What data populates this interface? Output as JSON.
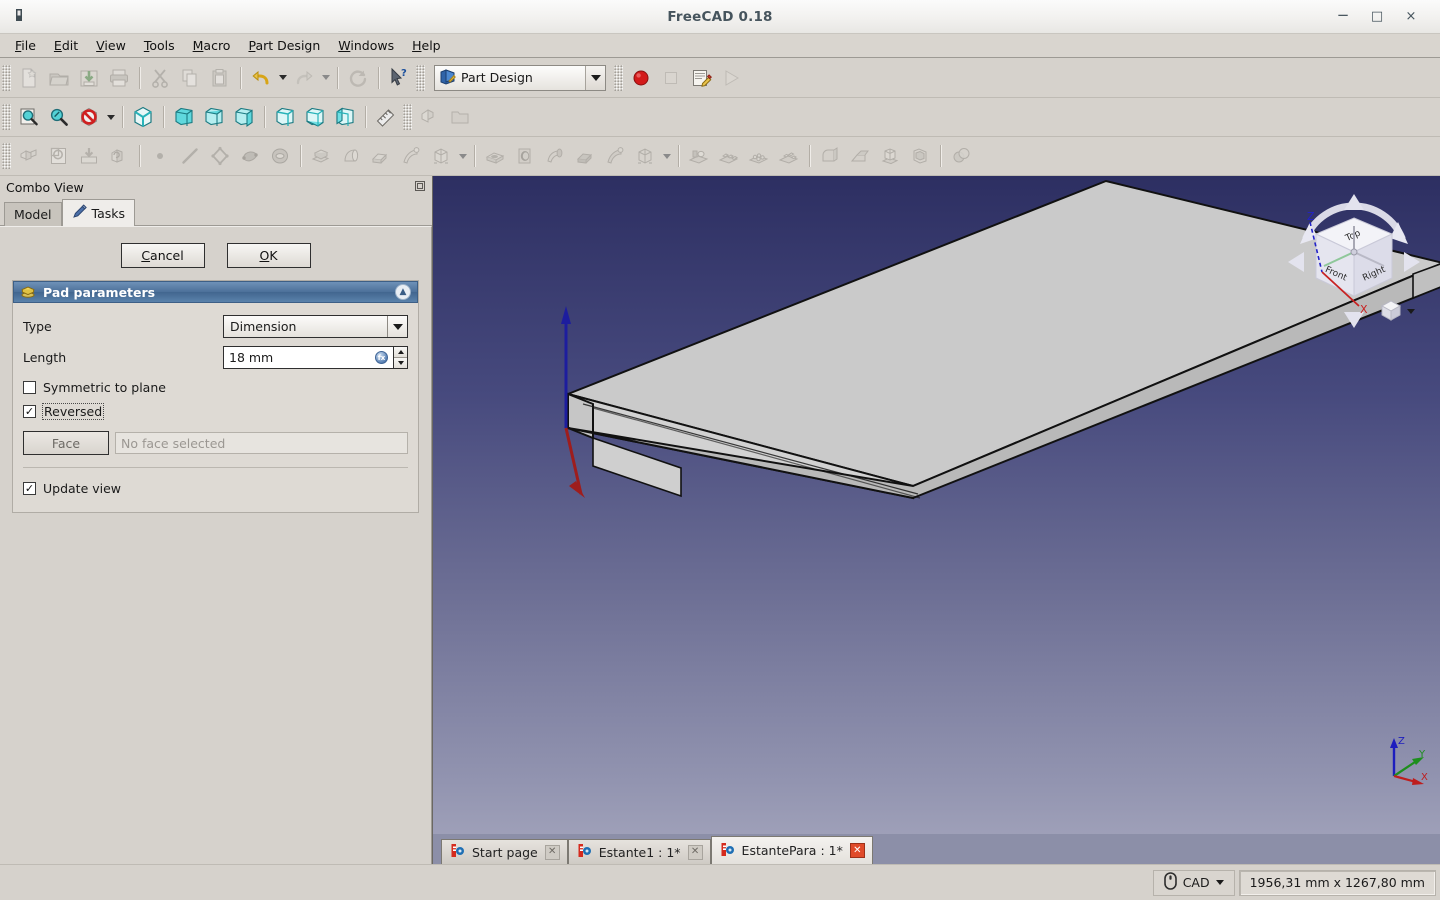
{
  "window": {
    "title": "FreeCAD 0.18",
    "app_icon": "freecad-icon",
    "controls": {
      "minimize": "−",
      "maximize": "□",
      "close": "×"
    }
  },
  "menubar": {
    "items": [
      {
        "label": "File",
        "accel": "F"
      },
      {
        "label": "Edit",
        "accel": "E"
      },
      {
        "label": "View",
        "accel": "V"
      },
      {
        "label": "Tools",
        "accel": "T"
      },
      {
        "label": "Macro",
        "accel": "M"
      },
      {
        "label": "Part Design",
        "accel": "P"
      },
      {
        "label": "Windows",
        "accel": "W"
      },
      {
        "label": "Help",
        "accel": "H"
      }
    ]
  },
  "toolbars": {
    "file": [
      {
        "name": "new-document-icon",
        "label": "New",
        "enabled": false
      },
      {
        "name": "open-document-icon",
        "label": "Open",
        "enabled": false
      },
      {
        "name": "save-document-icon",
        "label": "Save",
        "enabled": false
      },
      {
        "name": "print-icon",
        "label": "Print",
        "enabled": false
      },
      {
        "name": "cut-icon",
        "label": "Cut",
        "enabled": false
      },
      {
        "name": "copy-icon",
        "label": "Copy",
        "enabled": false
      },
      {
        "name": "paste-icon",
        "label": "Paste",
        "enabled": false
      },
      {
        "name": "undo-icon",
        "label": "Undo",
        "enabled": true
      },
      {
        "name": "redo-icon",
        "label": "Redo",
        "enabled": false
      },
      {
        "name": "refresh-icon",
        "label": "Refresh",
        "enabled": false
      },
      {
        "name": "whats-this-icon",
        "label": "What's This",
        "enabled": true
      }
    ],
    "workbench": {
      "label": "Part Design",
      "icon": "part-design-icon"
    },
    "macro": [
      {
        "name": "macro-record-icon",
        "label": "Macro recording",
        "enabled": true
      },
      {
        "name": "macro-stop-icon",
        "label": "Stop macro recording",
        "enabled": false
      },
      {
        "name": "macro-edit-icon",
        "label": "Macros",
        "enabled": true
      },
      {
        "name": "macro-execute-icon",
        "label": "Execute macro",
        "enabled": false
      }
    ],
    "view": [
      {
        "name": "fit-all-icon",
        "label": "Fit all",
        "enabled": true
      },
      {
        "name": "fit-selection-icon",
        "label": "Fit selection",
        "enabled": true
      },
      {
        "name": "draw-style-icon",
        "label": "Draw style",
        "enabled": true
      },
      {
        "name": "isometric-view-icon",
        "label": "Axonometric",
        "enabled": true
      },
      {
        "name": "front-view-icon",
        "label": "Front",
        "enabled": true
      },
      {
        "name": "top-view-icon",
        "label": "Top",
        "enabled": true
      },
      {
        "name": "right-view-icon",
        "label": "Right",
        "enabled": true
      },
      {
        "name": "rear-view-icon",
        "label": "Rear",
        "enabled": true
      },
      {
        "name": "bottom-view-icon",
        "label": "Bottom",
        "enabled": true
      },
      {
        "name": "left-view-icon",
        "label": "Left",
        "enabled": true
      },
      {
        "name": "measure-icon",
        "label": "Measure",
        "enabled": true
      }
    ],
    "structure": [
      {
        "name": "create-part-icon",
        "label": "Create part",
        "enabled": false
      },
      {
        "name": "create-group-icon",
        "label": "Create group",
        "enabled": false
      }
    ],
    "partdesign_helper": [
      {
        "name": "create-body-icon",
        "label": "Create body",
        "enabled": false
      },
      {
        "name": "create-sketch-icon",
        "label": "Create sketch",
        "enabled": false
      },
      {
        "name": "attach-sketch-icon",
        "label": "Attach sketch",
        "enabled": false
      },
      {
        "name": "validate-sketch-icon",
        "label": "Validate sketch",
        "enabled": false
      },
      {
        "name": "sketch-point-icon",
        "label": "Point",
        "enabled": false
      },
      {
        "name": "sketch-line-icon",
        "label": "Line",
        "enabled": false
      },
      {
        "name": "sketch-polyline-icon",
        "label": "Polyline",
        "enabled": false
      },
      {
        "name": "sketch-spline-icon",
        "label": "B-spline",
        "enabled": false
      },
      {
        "name": "sketch-shape-icon",
        "label": "Shape binder",
        "enabled": false
      }
    ],
    "additive": [
      {
        "name": "pad-icon",
        "label": "Pad",
        "enabled": false
      },
      {
        "name": "revolution-icon",
        "label": "Revolution",
        "enabled": false
      },
      {
        "name": "additive-loft-icon",
        "label": "Additive loft",
        "enabled": false
      },
      {
        "name": "additive-pipe-icon",
        "label": "Additive pipe",
        "enabled": false
      },
      {
        "name": "additive-box-icon",
        "label": "Additive box",
        "enabled": false
      }
    ],
    "subtractive": [
      {
        "name": "pocket-icon",
        "label": "Pocket",
        "enabled": false
      },
      {
        "name": "hole-icon",
        "label": "Hole",
        "enabled": false
      },
      {
        "name": "groove-icon",
        "label": "Groove",
        "enabled": false
      },
      {
        "name": "subtractive-loft-icon",
        "label": "Subtractive loft",
        "enabled": false
      },
      {
        "name": "subtractive-pipe-icon",
        "label": "Subtractive pipe",
        "enabled": false
      },
      {
        "name": "subtractive-box-icon",
        "label": "Subtractive box",
        "enabled": false
      }
    ],
    "transform": [
      {
        "name": "mirrored-icon",
        "label": "Mirrored",
        "enabled": false
      },
      {
        "name": "linear-pattern-icon",
        "label": "Linear pattern",
        "enabled": false
      },
      {
        "name": "polar-pattern-icon",
        "label": "Polar pattern",
        "enabled": false
      },
      {
        "name": "multi-transform-icon",
        "label": "Multi transform",
        "enabled": false
      }
    ],
    "dressup": [
      {
        "name": "fillet-icon",
        "label": "Fillet",
        "enabled": false
      },
      {
        "name": "chamfer-icon",
        "label": "Chamfer",
        "enabled": false
      },
      {
        "name": "draft-icon",
        "label": "Draft",
        "enabled": false
      },
      {
        "name": "thickness-icon",
        "label": "Thickness",
        "enabled": false
      },
      {
        "name": "boolean-icon",
        "label": "Boolean",
        "enabled": false
      }
    ]
  },
  "combo_view": {
    "title": "Combo View",
    "float_icon": "undock-icon",
    "tabs": [
      {
        "label": "Model",
        "active": false,
        "icon": null
      },
      {
        "label": "Tasks",
        "active": true,
        "icon": "pencil-icon"
      }
    ]
  },
  "task_panel": {
    "cancel_label": "Cancel",
    "cancel_accel": "C",
    "ok_label": "OK",
    "ok_accel": "O",
    "group": {
      "title": "Pad parameters",
      "icon": "pad-icon",
      "collapse_icon": "chevron-up-icon"
    },
    "type_label": "Type",
    "type_value": "Dimension",
    "length_label": "Length",
    "length_value": "18 mm",
    "length_expression_icon": "expression-editor-icon",
    "symmetric_label": "Symmetric to plane",
    "symmetric_checked": false,
    "reversed_label": "Reversed",
    "reversed_checked": true,
    "face_button_label": "Face",
    "face_input_placeholder": "No face selected",
    "update_view_label": "Update view",
    "update_view_checked": true
  },
  "view3d": {
    "navcube": {
      "top_label": "Top",
      "front_label": "Front",
      "right_label": "Right",
      "z_axis_label": "Z",
      "x_axis_label": "X"
    },
    "axis_cross": {
      "x": "X",
      "y": "Y",
      "z": "Z"
    }
  },
  "document_tabs": [
    {
      "label": "Start page",
      "active": false,
      "icon": "freecad-doc-icon"
    },
    {
      "label": "Estante1 : 1*",
      "active": false,
      "icon": "freecad-doc-icon"
    },
    {
      "label": "EstantePara : 1*",
      "active": true,
      "icon": "freecad-doc-icon"
    }
  ],
  "statusbar": {
    "navigation_style": "CAD",
    "navigation_icon": "mouse-icon",
    "dimensions": "1956,31 mm x 1267,80 mm"
  },
  "colors": {
    "titlebar_text": "#46545d",
    "group_header": "#4c7099",
    "window_bg": "#d6d2cc",
    "view_top": "#2d2f62",
    "view_bottom": "#a5a6bd",
    "solid_fill": "#c8c8c8",
    "active_close": "#e04b2a"
  }
}
